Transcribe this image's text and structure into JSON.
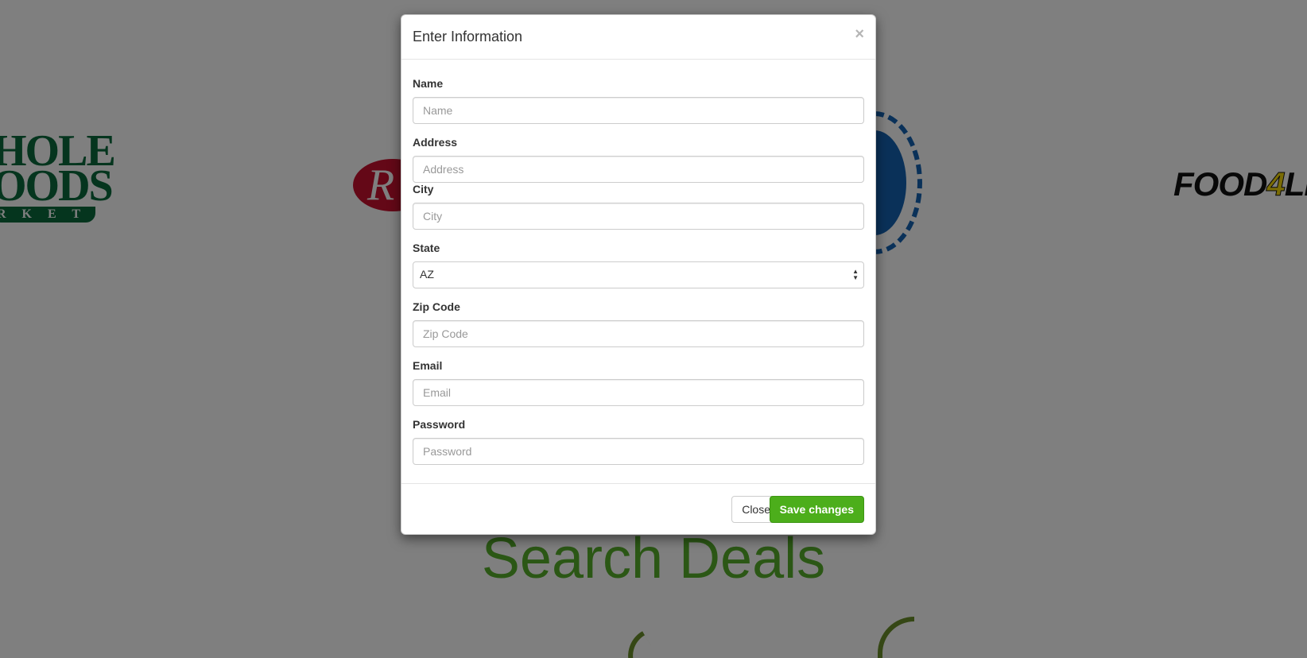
{
  "background": {
    "logos": {
      "whole_foods": {
        "line1": "HOLE",
        "line2": "OODS",
        "line3": "R K E T"
      },
      "ralphs": {
        "text": "R"
      },
      "food4less": {
        "part1": "FOOD",
        "part2": "4",
        "part3": "LES"
      }
    },
    "headline": "Search Deals"
  },
  "modal": {
    "title": "Enter Information",
    "close_icon": "×",
    "fields": [
      {
        "label": "Name",
        "placeholder": "Name",
        "value": ""
      },
      {
        "label": "Address",
        "placeholder": "Address",
        "value": ""
      },
      {
        "label": "City",
        "placeholder": "City",
        "value": ""
      },
      {
        "label": "State",
        "selected": "AZ"
      },
      {
        "label": "Zip Code",
        "placeholder": "Zip Code",
        "value": ""
      },
      {
        "label": "Email",
        "placeholder": "Email",
        "value": ""
      },
      {
        "label": "Password",
        "placeholder": "Password",
        "value": ""
      }
    ],
    "footer": {
      "close_label": "Close",
      "save_label": "Save changes"
    }
  },
  "colors": {
    "accent_green": "#4cae1b",
    "headline_green": "#56ae2b",
    "backdrop": "rgba(0,0,0,0.5)"
  }
}
